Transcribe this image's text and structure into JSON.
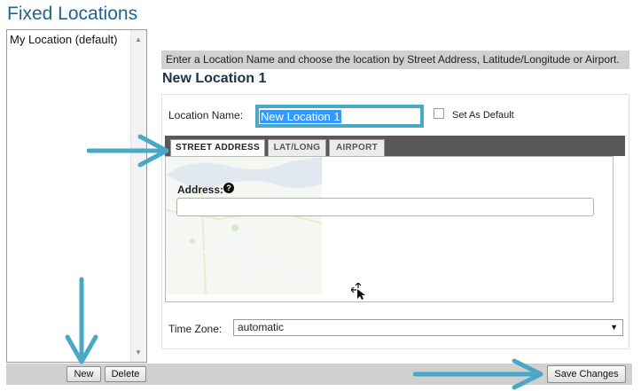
{
  "page": {
    "title": "Fixed Locations"
  },
  "locations": {
    "items": [
      {
        "label": "My Location  (default)"
      }
    ],
    "scroll_up_icon": "triangle-up",
    "scroll_down_icon": "triangle-down"
  },
  "bottom": {
    "new_label": "New",
    "delete_label": "Delete",
    "save_label": "Save Changes"
  },
  "form": {
    "instructions": "Enter a Location Name and choose the location by Street Address, Latitude/Longitude or Airport.",
    "heading": "New Location 1",
    "name_label": "Location Name:",
    "name_value": "New Location 1",
    "set_default_label": "Set As Default",
    "set_default_checked": false,
    "tabs": [
      {
        "label": "STREET ADDRESS",
        "active": true
      },
      {
        "label": "LAT/LONG",
        "active": false
      },
      {
        "label": "AIRPORT",
        "active": false
      }
    ],
    "address_label": "Address:",
    "help_icon": "?",
    "address_value": "",
    "timezone_label": "Time Zone:",
    "timezone_value": "automatic",
    "timezone_caret": "▼"
  },
  "colors": {
    "title": "#1a6496",
    "annotation_arrow": "#48a8c6",
    "selection": "#3399ff",
    "bar": "#d0d0d0",
    "tab_strip": "#585858"
  }
}
